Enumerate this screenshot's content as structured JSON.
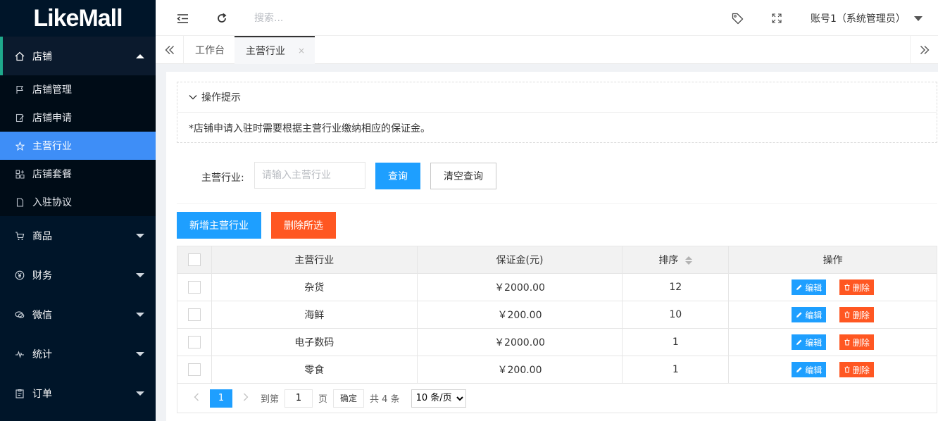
{
  "brand": {
    "logo_text_1": "Lik",
    "logo_text_2": "e",
    "logo_text_3": "Mall"
  },
  "sidebar": {
    "group_store": "店铺",
    "sub_items": [
      "店铺管理",
      "店铺申请",
      "主营行业",
      "店铺套餐",
      "入驻协议"
    ],
    "groups": [
      "商品",
      "财务",
      "微信",
      "统计",
      "订单"
    ]
  },
  "header": {
    "search_placeholder": "搜索...",
    "account": "账号1（系统管理员）"
  },
  "tabs": [
    {
      "label": "工作台"
    },
    {
      "label": "主营行业",
      "close": "×"
    }
  ],
  "tip": {
    "title": "操作提示",
    "text": "*店铺申请入驻时需要根据主营行业缴纳相应的保证金。"
  },
  "filter": {
    "label": "主营行业:",
    "placeholder": "请输入主营行业",
    "query": "查询",
    "clear": "清空查询"
  },
  "actions": {
    "add": "新增主营行业",
    "delete_selected": "删除所选"
  },
  "table": {
    "headers": [
      "主营行业",
      "保证金(元)",
      "排序",
      "操作"
    ],
    "rows": [
      {
        "name": "杂货",
        "deposit": "￥2000.00",
        "sort": "12"
      },
      {
        "name": "海鲜",
        "deposit": "￥200.00",
        "sort": "10"
      },
      {
        "name": "电子数码",
        "deposit": "￥2000.00",
        "sort": "1"
      },
      {
        "name": "零食",
        "deposit": "￥200.00",
        "sort": "1"
      }
    ],
    "edit_label": "编辑",
    "delete_label": "删除"
  },
  "pager": {
    "current": "1",
    "goto_prefix": "到第",
    "goto_value": "1",
    "goto_suffix": "页",
    "confirm": "确定",
    "total": "共 4 条",
    "page_size": "10 条/页"
  }
}
